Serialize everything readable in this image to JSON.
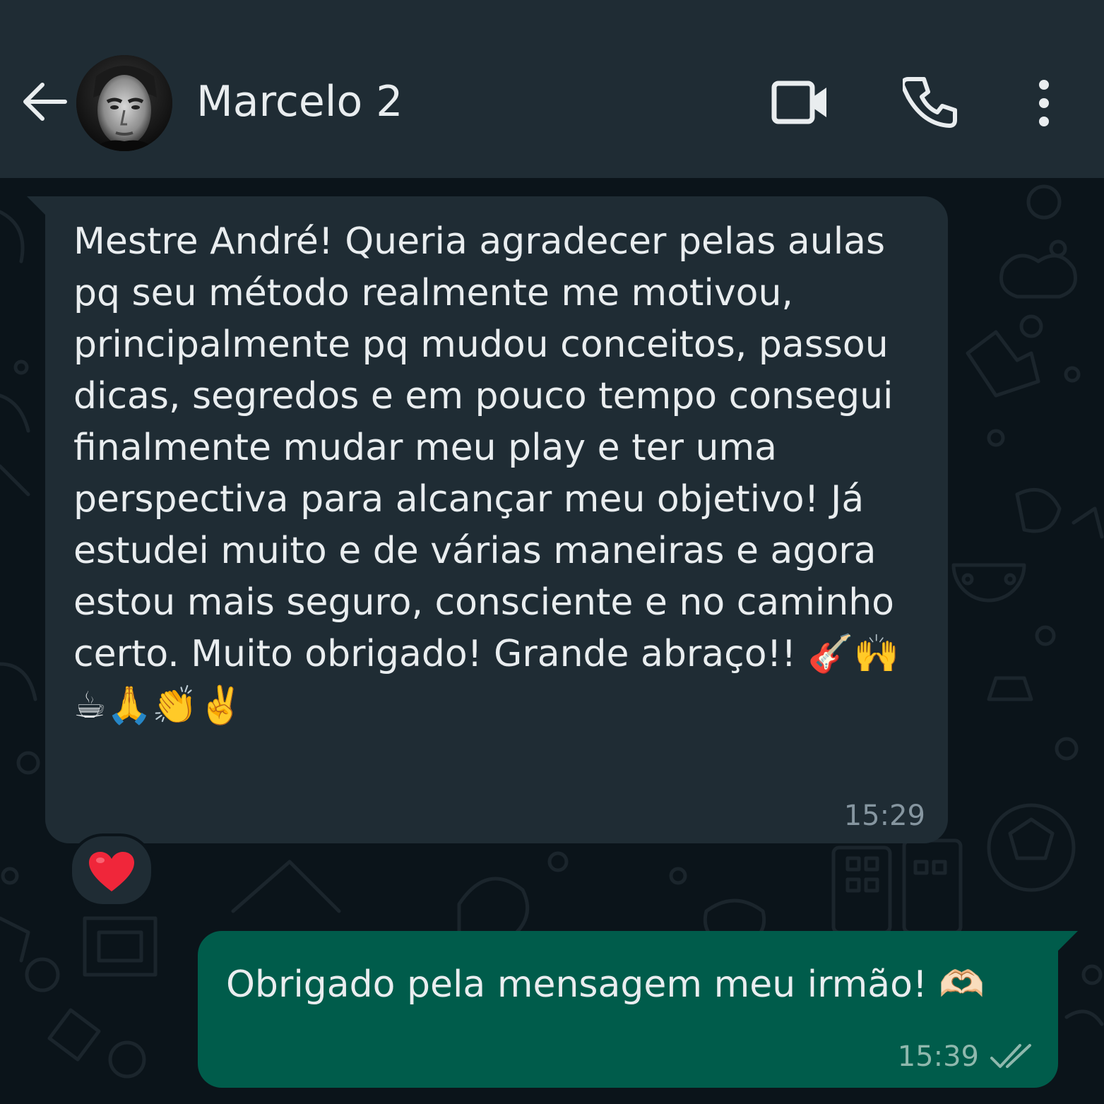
{
  "header": {
    "contact_name": "Marcelo 2",
    "back_icon": "arrow-left-icon",
    "video_icon": "video-camera-icon",
    "call_icon": "phone-icon",
    "menu_icon": "more-vertical-icon"
  },
  "messages": [
    {
      "direction": "incoming",
      "text": "Mestre André! Queria agradecer pelas aulas pq seu método realmente me motivou, principalmente pq mudou conceitos, passou dicas, segredos e em pouco tempo consegui finalmente mudar meu play e ter uma perspectiva para alcançar meu objetivo! Já estudei muito e de várias maneiras e agora estou mais seguro, consciente e no caminho certo. Muito obrigado! Grande abraço!! 🎸🙌☕🙏👏✌️",
      "time": "15:29",
      "reaction": "❤️"
    },
    {
      "direction": "outgoing",
      "text": "Obrigado pela mensagem meu irmão! 🫶🏻",
      "time": "15:39",
      "status_icon": "double-check-read-icon"
    }
  ],
  "colors": {
    "header_bg": "#1f2c34",
    "chat_bg": "#0b141a",
    "incoming_bubble": "#1f2c34",
    "outgoing_bubble": "#005c4b",
    "primary_text": "#e9edef",
    "secondary_text": "#8696a0",
    "read_ticks": "#8fb8ad"
  }
}
